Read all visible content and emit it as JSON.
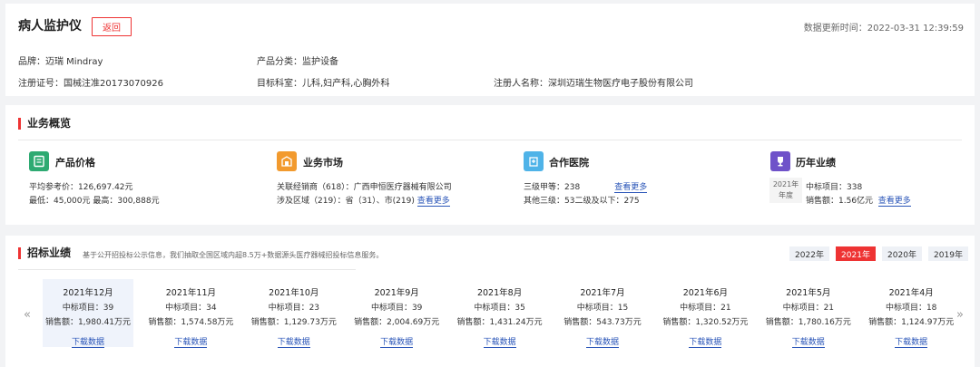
{
  "header": {
    "title": "病人监护仪",
    "back_label": "返回",
    "update_label": "数据更新时间：",
    "update_time": "2022-03-31 12:39:59",
    "brand": "品牌：迈瑞 Mindray",
    "category": "产品分类：监护设备",
    "reg_no": "注册证号：国械注准20173070926",
    "departments": "目标科室：儿科,妇产科,心胸外科",
    "registrant": "注册人名称：深圳迈瑞生物医疗电子股份有限公司"
  },
  "overview": {
    "title": "业务概览",
    "price": {
      "icon": "price-list-icon",
      "title": "产品价格",
      "line1": "平均参考价：126,697.42元",
      "line2": "最低：45,000元 最高：300,888元"
    },
    "market": {
      "icon": "market-box-icon",
      "title": "业务市场",
      "line1": "关联经销商（618）：广西申恒医疗器械有限公司",
      "line2": "涉及区域（219）：省（31）、市(219)",
      "more": "查看更多"
    },
    "hospital": {
      "icon": "hospital-building-icon",
      "title": "合作医院",
      "line1": "三级甲等：238",
      "line2": "其他三级：53二级及以下：275",
      "more": "查看更多"
    },
    "history": {
      "icon": "trophy-icon",
      "title": "历年业绩",
      "year_top": "2021年",
      "year_bottom": "年度",
      "line1": "中标项目：338",
      "line2": "销售额：1.56亿元",
      "more": "查看更多"
    },
    "colors": {
      "price": "#2eaa72",
      "market": "#f29a2e",
      "hospital": "#4fb3e8",
      "history": "#6f52c9"
    }
  },
  "tender": {
    "title": "招标业绩",
    "note": "基于公开招投标公示信息，我们抽取全国区域内超8.5万+数据源头医疗器械招投标信息服务。",
    "years": [
      "2022年",
      "2021年",
      "2020年",
      "2019年"
    ],
    "active_year": 1,
    "months": [
      {
        "label": "2021年12月",
        "projects": "中标项目：39",
        "sales": "销售额：1,980.41万元",
        "download": "下载数据"
      },
      {
        "label": "2021年11月",
        "projects": "中标项目：34",
        "sales": "销售额：1,574.58万元",
        "download": "下载数据"
      },
      {
        "label": "2021年10月",
        "projects": "中标项目：23",
        "sales": "销售额：1,129.73万元",
        "download": "下载数据"
      },
      {
        "label": "2021年9月",
        "projects": "中标项目：39",
        "sales": "销售额：2,004.69万元",
        "download": "下载数据"
      },
      {
        "label": "2021年8月",
        "projects": "中标项目：35",
        "sales": "销售额：1,431.24万元",
        "download": "下载数据"
      },
      {
        "label": "2021年7月",
        "projects": "中标项目：15",
        "sales": "销售额：543.73万元",
        "download": "下载数据"
      },
      {
        "label": "2021年6月",
        "projects": "中标项目：21",
        "sales": "销售额：1,320.52万元",
        "download": "下载数据"
      },
      {
        "label": "2021年5月",
        "projects": "中标项目：21",
        "sales": "销售额：1,780.16万元",
        "download": "下载数据"
      },
      {
        "label": "2021年4月",
        "projects": "中标项目：18",
        "sales": "销售额：1,124.97万元",
        "download": "下载数据"
      }
    ],
    "prev_arrow": "«",
    "next_arrow": "»"
  }
}
